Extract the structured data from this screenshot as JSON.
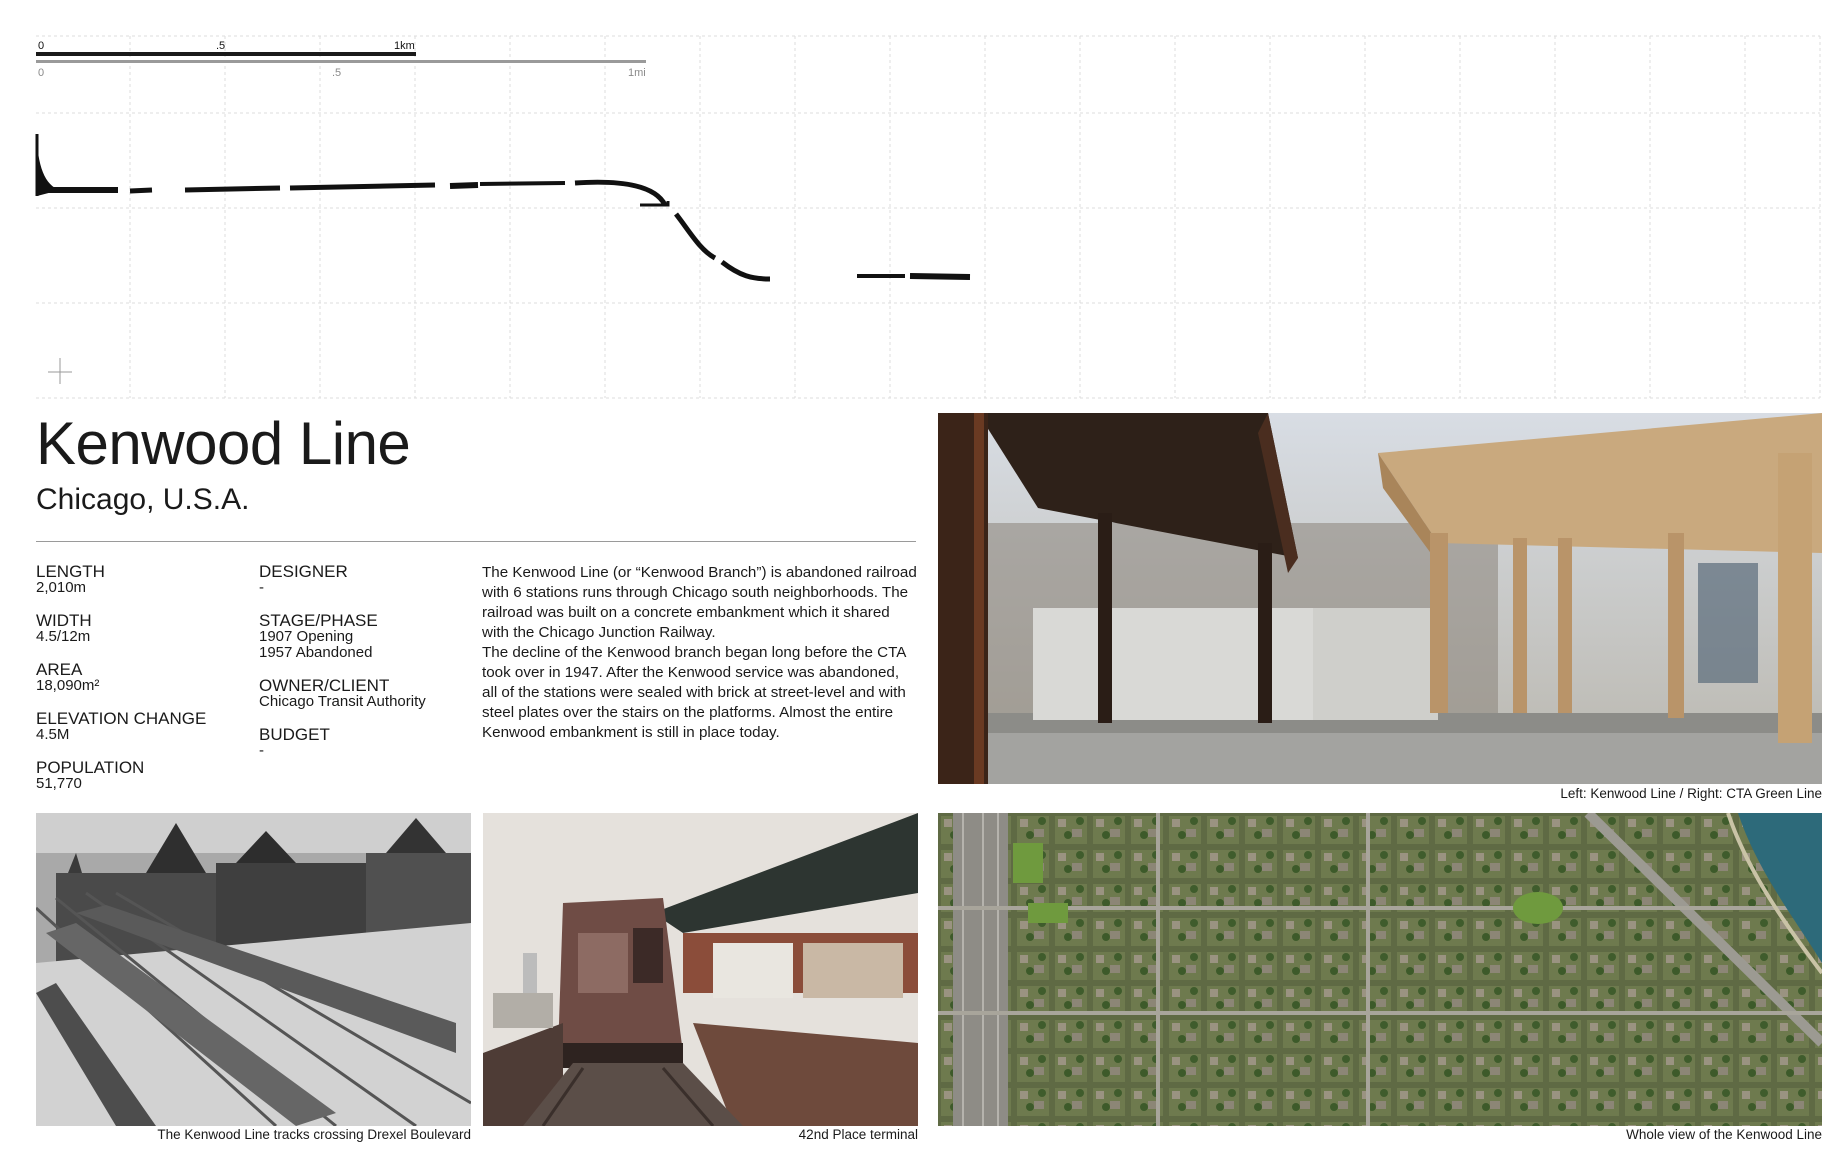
{
  "scalebar": {
    "km_ticks": [
      "0",
      ".5",
      "1km"
    ],
    "mi_ticks": [
      "0",
      ".5",
      "1mi"
    ]
  },
  "header": {
    "title": "Kenwood Line",
    "subtitle": "Chicago, U.S.A."
  },
  "specs_left": [
    {
      "label": "LENGTH",
      "value": "2,010m"
    },
    {
      "label": "WIDTH",
      "value": "4.5/12m"
    },
    {
      "label": "AREA",
      "value": "18,090m²"
    },
    {
      "label": "ELEVATION CHANGE",
      "value": "4.5M"
    },
    {
      "label": "POPULATION",
      "value": "51,770"
    }
  ],
  "specs_right": [
    {
      "label": "DESIGNER",
      "value": "-"
    },
    {
      "label": "STAGE/PHASE",
      "value": "1907 Opening",
      "value2": "1957 Abandoned"
    },
    {
      "label": "OWNER/CLIENT",
      "value": "Chicago Transit Authority"
    },
    {
      "label": "BUDGET",
      "value": "-"
    }
  ],
  "description": {
    "p1": "The Kenwood Line (or “Kenwood Branch”) is abandoned railroad with 6 stations runs through Chicago south neighborhoods. The railroad was built on a concrete embankment which it shared with the Chicago Junction Railway.",
    "p2": "The decline of the Kenwood branch began long before the CTA took over in 1947. After the Kenwood service was abandoned, all of the stations were sealed with brick at street-level and with steel plates over the stairs on the platforms. Almost the entire Kenwood embankment is still in place today."
  },
  "captions": {
    "elevated_photo": "Left: Kenwood Line / Right: CTA Green Line",
    "historic_photo": "The Kenwood Line tracks crossing Drexel Boulevard",
    "terminal_photo": "42nd Place terminal",
    "aerial_photo": "Whole view of the Kenwood Line"
  },
  "colors": {
    "line": "#111111",
    "grid": "#d9d9d9",
    "rust": "#5a2e1f",
    "green_steel": "#c8a57c"
  }
}
